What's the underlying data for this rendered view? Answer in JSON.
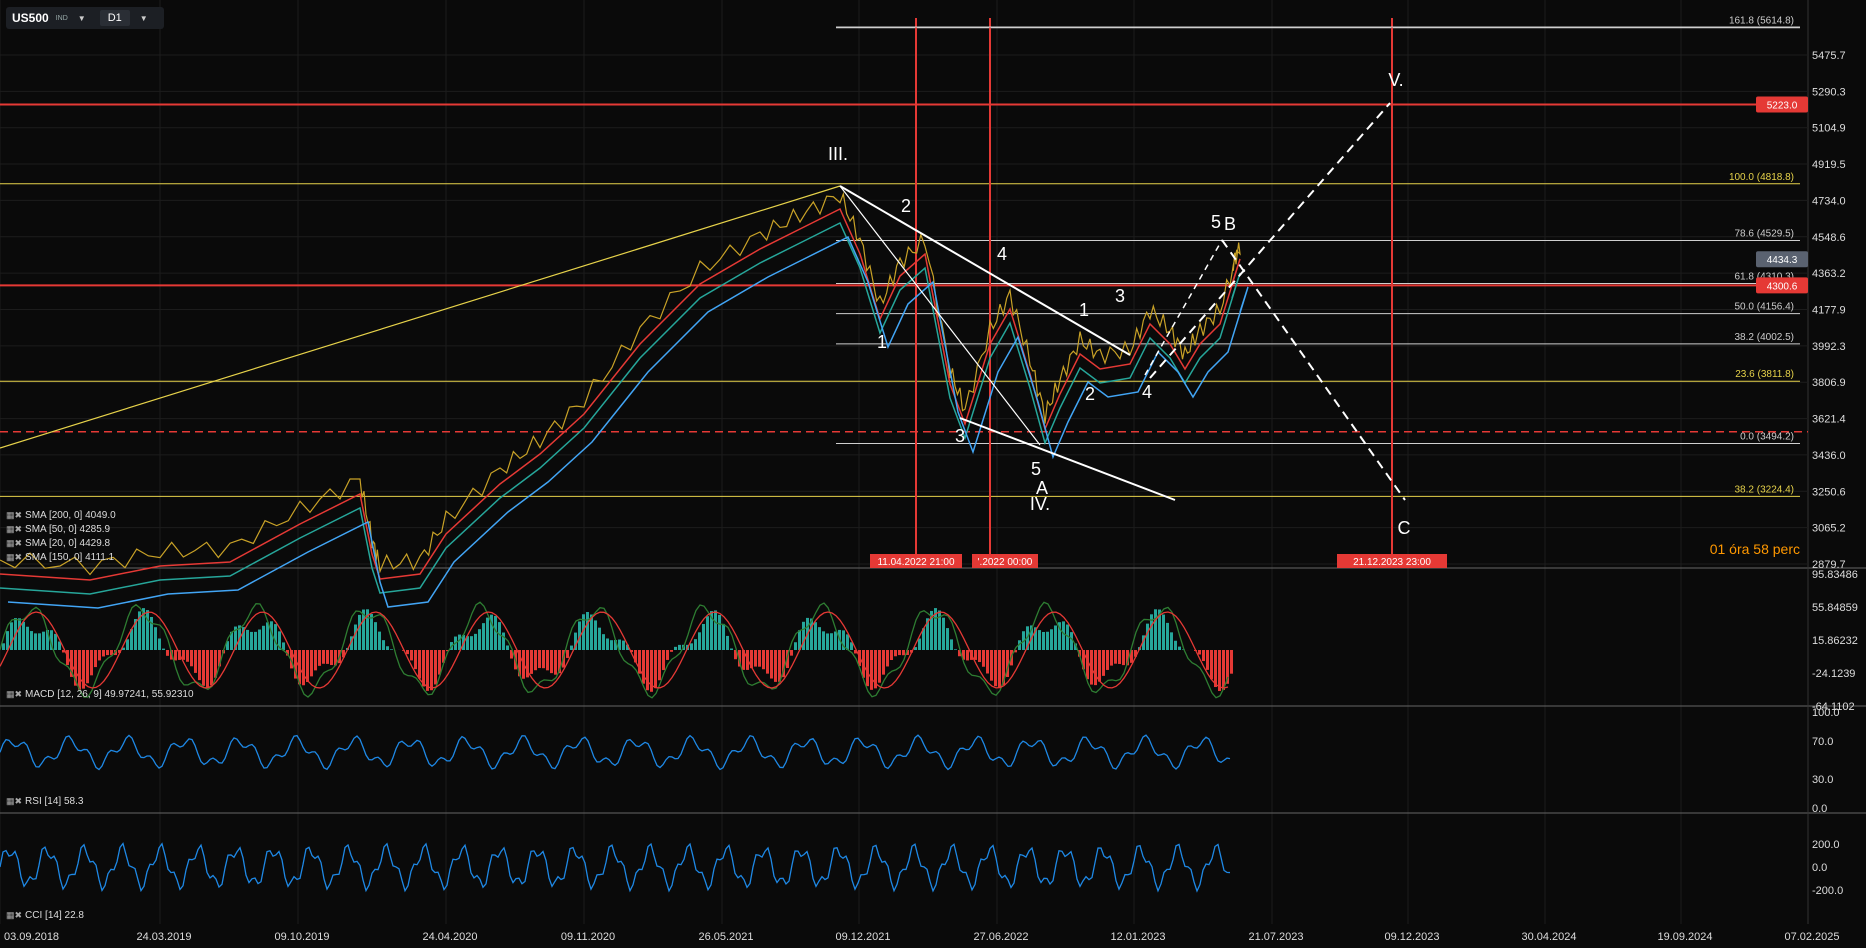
{
  "toolbar": {
    "symbol": "US500",
    "symbol_sub": "IND",
    "timeframe": "D1"
  },
  "colors": {
    "bg": "#0a0a0a",
    "grid": "#1c1c1c",
    "up": "#26a69a",
    "down": "#ef5350",
    "fib": "#e6d24a",
    "red": "#e53935",
    "white": "#ffffff",
    "blue": "#1e88e5"
  },
  "chart_data": {
    "type": "line",
    "price_axis": {
      "ticks": [
        "5475.7",
        "5290.3",
        "5104.9",
        "4919.5",
        "4734.0",
        "4548.6",
        "4363.2",
        "4177.9",
        "3992.3",
        "3806.9",
        "3621.4",
        "3436.0",
        "3250.6",
        "3065.2",
        "2879.7"
      ],
      "ylim": [
        2879.7,
        5660
      ]
    },
    "date_axis": {
      "ticks": [
        "03.09.2018",
        "24.03.2019",
        "09.10.2019",
        "24.04.2020",
        "09.11.2020",
        "26.05.2021",
        "09.12.2021",
        "27.06.2022",
        "12.01.2023",
        "21.07.2023",
        "09.12.2023",
        "30.04.2024",
        "19.09.2024",
        "07.02.2025"
      ]
    },
    "price_tags": [
      {
        "label": "5223.0",
        "value": 5223.0
      },
      {
        "label": "4434.3",
        "value": 4434.3
      },
      {
        "label": "4300.6",
        "value": 4300.6
      }
    ],
    "fib_levels": [
      {
        "label": "161.8 (5614.8)",
        "value": 5614.8
      },
      {
        "label": "100.0 (4818.8)",
        "value": 4818.8
      },
      {
        "label": "78.6 (4529.5)",
        "value": 4529.5
      },
      {
        "label": "61.8 (4310.3)",
        "value": 4310.3
      },
      {
        "label": "50.0 (4156.4)",
        "value": 4156.4
      },
      {
        "label": "38.2 (4002.5)",
        "value": 4002.5
      },
      {
        "label": "23.6 (3811.8)",
        "value": 3811.8
      },
      {
        "label": "0.0 (3494.2)",
        "value": 3494.2
      },
      {
        "label": "38.2 (3224.4)",
        "value": 3224.4
      }
    ],
    "wave_labels": [
      "III.",
      "IV.",
      "V.",
      "1",
      "2",
      "3",
      "4",
      "5",
      "A",
      "B",
      "C",
      "1",
      "2",
      "3",
      "4",
      "5"
    ],
    "vertical_markers": [
      "11.04.2022 21:00",
      "'.2022 00:00",
      "21.12.2023 23:00"
    ],
    "sma": [
      {
        "name": "SMA [200, 0]",
        "value": "4049.0",
        "color": "#42a5f5"
      },
      {
        "name": "SMA [50, 0]",
        "value": "4285.9",
        "color": "#ef5350"
      },
      {
        "name": "SMA [20, 0]",
        "value": "4429.8",
        "color": "#fdd835"
      },
      {
        "name": "SMA [150, 0]",
        "value": "4111.1",
        "color": "#26a69a"
      }
    ],
    "macd": {
      "label": "MACD [12, 26, 9] 49.97241, 55.92310",
      "ticks": [
        "95.83486",
        "55.84859",
        "15.86232",
        "-24.1239",
        "-64.1102"
      ]
    },
    "rsi": {
      "label": "RSI [14] 58.3",
      "ticks": [
        "100.0",
        "70.0",
        "30.0",
        "0.0"
      ]
    },
    "cci": {
      "label": "CCI [14] 22.8",
      "ticks": [
        "200.0",
        "0.0",
        "-200.0"
      ]
    },
    "timer": {
      "hours": "01",
      "hours_unit": "óra",
      "minutes": "58",
      "minutes_unit": "perc"
    }
  }
}
